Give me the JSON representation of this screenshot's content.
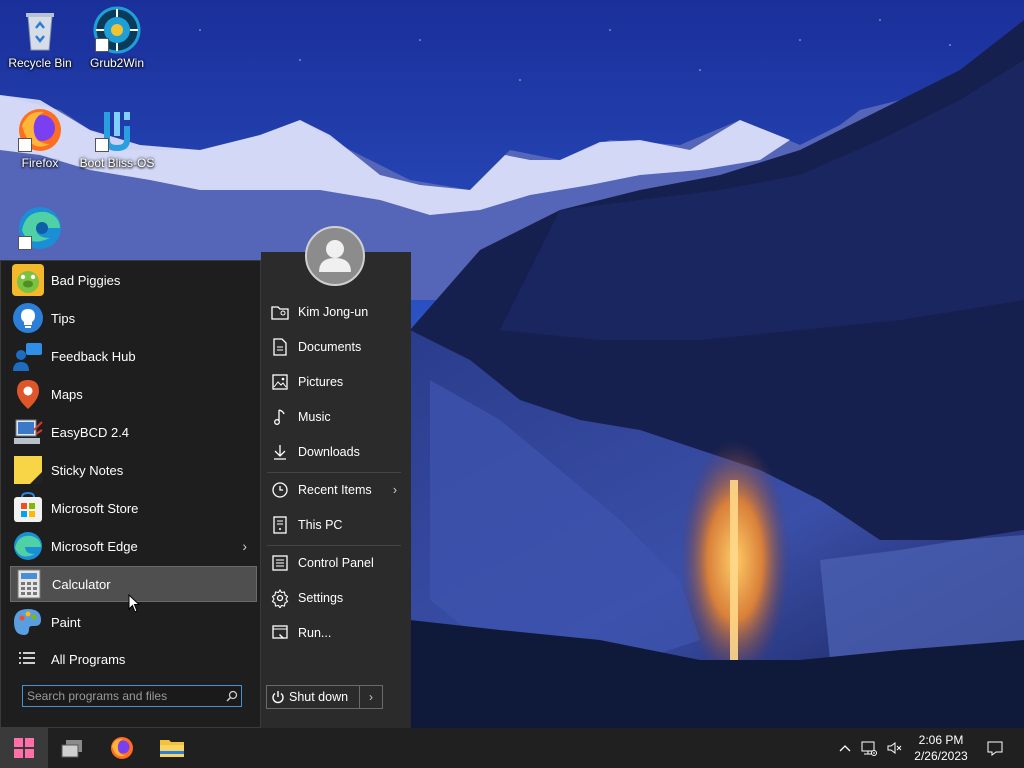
{
  "desktop": {
    "icons": [
      {
        "label": "Recycle Bin",
        "icon": "recycle-bin-icon"
      },
      {
        "label": "Grub2Win",
        "icon": "grub2win-icon"
      },
      {
        "label": "Firefox",
        "icon": "firefox-icon"
      },
      {
        "label": "Boot Bliss-OS",
        "icon": "bliss-os-icon"
      },
      {
        "label": "",
        "icon": "edge-icon"
      }
    ]
  },
  "start_menu": {
    "programs": [
      {
        "label": "Bad Piggies",
        "icon": "bad-piggies-icon"
      },
      {
        "label": "Tips",
        "icon": "tips-icon"
      },
      {
        "label": "Feedback Hub",
        "icon": "feedback-hub-icon"
      },
      {
        "label": "Maps",
        "icon": "maps-icon"
      },
      {
        "label": "EasyBCD 2.4",
        "icon": "easybcd-icon"
      },
      {
        "label": "Sticky Notes",
        "icon": "sticky-notes-icon"
      },
      {
        "label": "Microsoft Store",
        "icon": "microsoft-store-icon"
      },
      {
        "label": "Microsoft Edge",
        "icon": "edge-icon",
        "has_submenu": true
      },
      {
        "label": "Calculator",
        "icon": "calculator-icon",
        "highlighted": true
      },
      {
        "label": "Paint",
        "icon": "paint-icon"
      }
    ],
    "all_programs": "All Programs",
    "search_placeholder": "Search programs and files",
    "places": [
      {
        "label": "Kim Jong-un",
        "icon": "user-folder-icon"
      },
      {
        "label": "Documents",
        "icon": "documents-icon"
      },
      {
        "label": "Pictures",
        "icon": "pictures-icon"
      },
      {
        "label": "Music",
        "icon": "music-icon"
      },
      {
        "label": "Downloads",
        "icon": "downloads-icon"
      },
      {
        "label": "Recent Items",
        "icon": "recent-items-icon",
        "has_submenu": true
      },
      {
        "label": "This PC",
        "icon": "this-pc-icon"
      },
      {
        "label": "Control Panel",
        "icon": "control-panel-icon"
      },
      {
        "label": "Settings",
        "icon": "settings-icon"
      },
      {
        "label": "Run...",
        "icon": "run-icon"
      }
    ],
    "shutdown_label": "Shut down"
  },
  "taskbar": {
    "clock_time": "2:06 PM",
    "clock_date": "2/26/2023"
  },
  "colors": {
    "menu_bg": "#1e1e1e",
    "places_bg": "#2b2b2b",
    "taskbar_bg": "#202020",
    "highlight": "#4f4f4f",
    "accent": "#4a90d9"
  }
}
